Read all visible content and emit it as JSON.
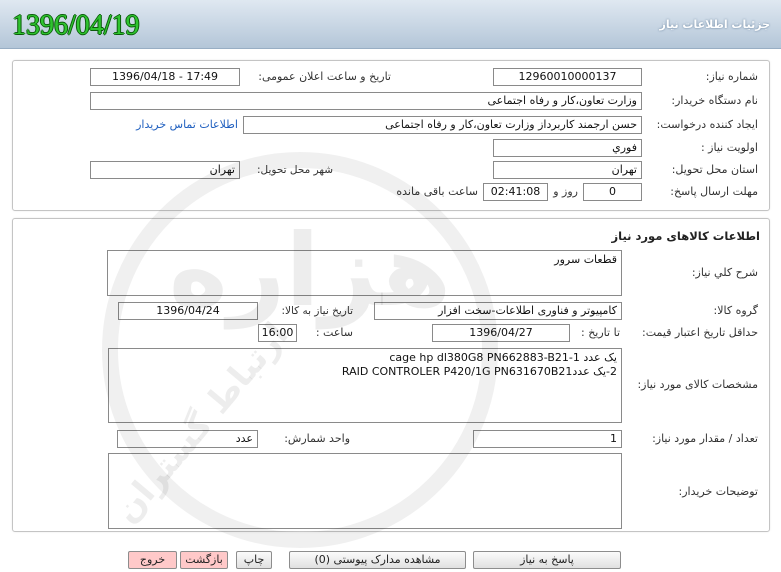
{
  "header": {
    "title": "جزئیات اطلاعات نیاز",
    "date": "1396/04/19"
  },
  "colors": {
    "header_title": "#ffffff",
    "date": "#2fc42f",
    "link": "#1f5fbf",
    "danger_button": "#ffc9c9"
  },
  "watermark": {
    "main": "هزاره",
    "sub": "ارتباط گستران"
  },
  "request": {
    "need_number": {
      "label": "شماره نیاز:",
      "value": "12960010000137"
    },
    "announce": {
      "label": "تاریخ و ساعت اعلان عمومی:",
      "value": "1396/04/18 - 17:49"
    },
    "buyer_org": {
      "label": "نام دستگاه خریدار:",
      "value": "وزارت تعاون،کار و رفاه اجتماعی"
    },
    "requester": {
      "label": "ایجاد کننده درخواست:",
      "value": "حسن ارجمند کاربرداز وزارت تعاون،کار و رفاه اجتماعی"
    },
    "contact_link": "اطلاعات تماس خریدار",
    "priority": {
      "label": "اولویت نیاز :",
      "value": "فوري"
    },
    "province": {
      "label": "استان محل تحویل:",
      "value": "تهران"
    },
    "city": {
      "label": "شهر محل تحویل:",
      "value": "تهران"
    },
    "deadline": {
      "label": "مهلت ارسال پاسخ:",
      "days": "0",
      "days_suffix": "روز و",
      "time": "02:41:08",
      "time_suffix": "ساعت باقی مانده"
    }
  },
  "goods": {
    "heading": "اطلاعات کالاهای مورد نیاز",
    "general_desc": {
      "label": "شرح کلي نياز:",
      "value": "قطعات سرور"
    },
    "group": {
      "label": "گروه کالا:",
      "value": "کامپیوتر و فناوری اطلاعات-سخت افزار"
    },
    "need_date": {
      "label": "تاریخ نیاز به کالا:",
      "value": "1396/04/24"
    },
    "price_validity": {
      "label": "حداقل تاریخ اعتبار قیمت:",
      "date_label": "تا تاریخ :",
      "date": "1396/04/27",
      "time_label": "ساعت :",
      "time": "16:00"
    },
    "spec": {
      "label": "مشخصات کالای مورد نیاز:",
      "lines": [
        "cage hp dl380G8 PN662883-B21-1 یک عدد",
        "2-یک عددRAID CONTROLER P420/1G PN631670B21"
      ]
    },
    "quantity": {
      "label": "تعداد / مقدار مورد نیاز:",
      "value": "1"
    },
    "unit": {
      "label": "واحد شمارش:",
      "value": "عدد"
    },
    "buyer_notes": {
      "label": "توضیحات خریدار:"
    }
  },
  "actions": {
    "reply": "پاسخ به نیاز",
    "attachments": "مشاهده مدارک پیوستی (0)",
    "print": "چاپ",
    "back": "بازگشت",
    "exit": "خروج"
  }
}
